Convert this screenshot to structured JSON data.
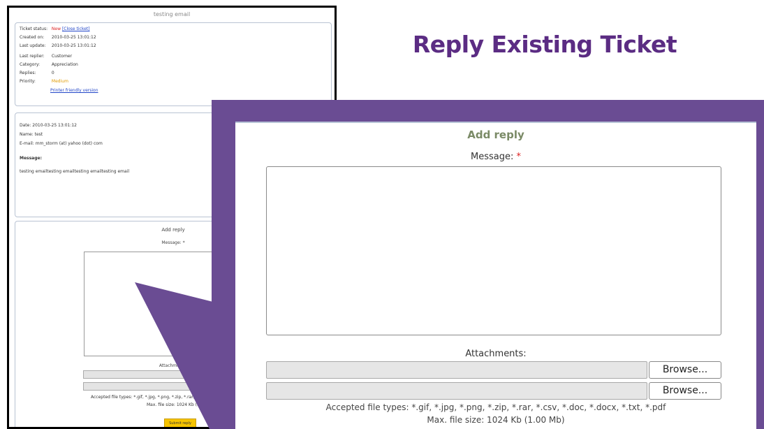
{
  "slide": {
    "title": "Reply Existing Ticket"
  },
  "small_screenshot": {
    "title": "testing email",
    "ticket": {
      "status_label": "Ticket status:",
      "status_value": "New",
      "close_link": "[Close ticket]",
      "created_label": "Created on:",
      "created_value": "2010-03-25 13:01:12",
      "updated_label": "Last update:",
      "updated_value": "2010-03-25 13:01:12",
      "replier_label": "Last replier:",
      "replier_value": "Customer",
      "category_label": "Category:",
      "category_value": "Appreciation",
      "replies_label": "Replies:",
      "replies_value": "0",
      "priority_label": "Priority:",
      "priority_value": "Medium",
      "printer_link": "Printer friendly version"
    },
    "message": {
      "date_line": "Date:  2010-03-25 13:01:12",
      "name_line": "Name:  test",
      "email_line": "E-mail:  mm_storm (at) yahoo (dot) com",
      "message_heading": "Message:",
      "message_body": "testing emailtesting emailtesting emailtesting email"
    },
    "reply": {
      "title": "Add reply",
      "message_label": "Message: *",
      "attachments_label": "Attachments:",
      "accepted_note": "Accepted file types: *.gif, *.jpg, *.png, *.zip, *.rar, *.csv, *...",
      "max_note": "Max. file size: 1024 Kb (1.00 Mb)",
      "submit_label": "Submit reply"
    }
  },
  "add_reply": {
    "title": "Add reply",
    "message_label": "Message:",
    "required_mark": "*",
    "attachments_label": "Attachments:",
    "browse_label": "Browse...",
    "accepted_types": "Accepted file types: *.gif, *.jpg, *.png, *.zip, *.rar, *.csv, *.doc, *.docx, *.txt, *.pdf",
    "max_size": "Max. file size: 1024 Kb (1.00 Mb)"
  },
  "colors": {
    "accent_purple": "#6a4c93",
    "title_purple": "#5b2c83",
    "submit_yellow": "#f6c400"
  }
}
